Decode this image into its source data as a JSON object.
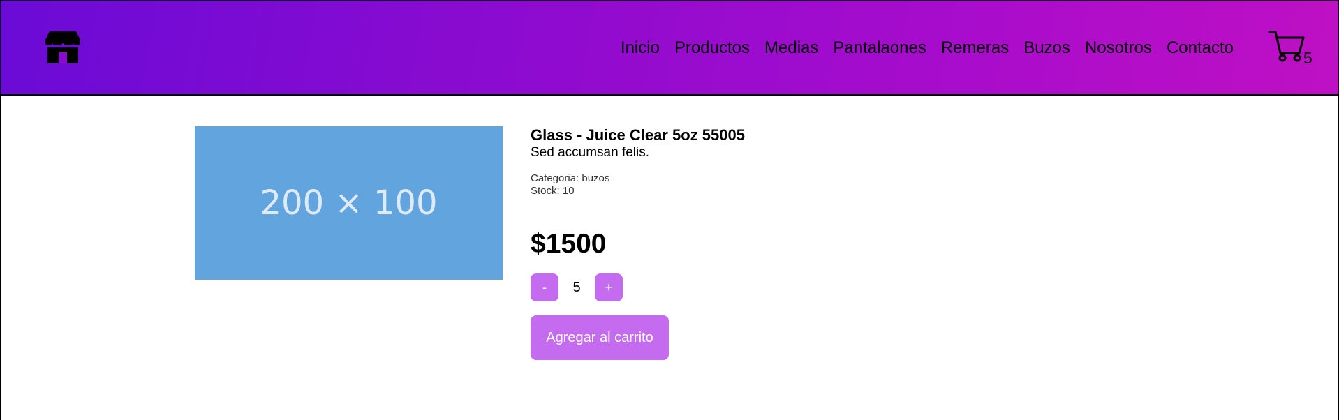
{
  "navbar": {
    "logo_icon": "storefront-icon",
    "links": [
      "Inicio",
      "Productos",
      "Medias",
      "Pantalaones",
      "Remeras",
      "Buzos",
      "Nosotros",
      "Contacto"
    ],
    "cart_icon": "cart-icon",
    "cart_count": "5",
    "gradient_start": "#6a0bd6",
    "gradient_end": "#bf10c4"
  },
  "product": {
    "image_placeholder": "200 × 100",
    "image_color": "#62a4de",
    "title": "Glass - Juice Clear 5oz 55005",
    "description": "Sed accumsan felis.",
    "category": "Categoria: buzos",
    "stock": "Stock: 10",
    "price": "$1500",
    "quantity": "5",
    "decrement_label": "-",
    "increment_label": "+",
    "add_to_cart_label": "Agregar al carrito",
    "button_color": "#c56bef"
  }
}
